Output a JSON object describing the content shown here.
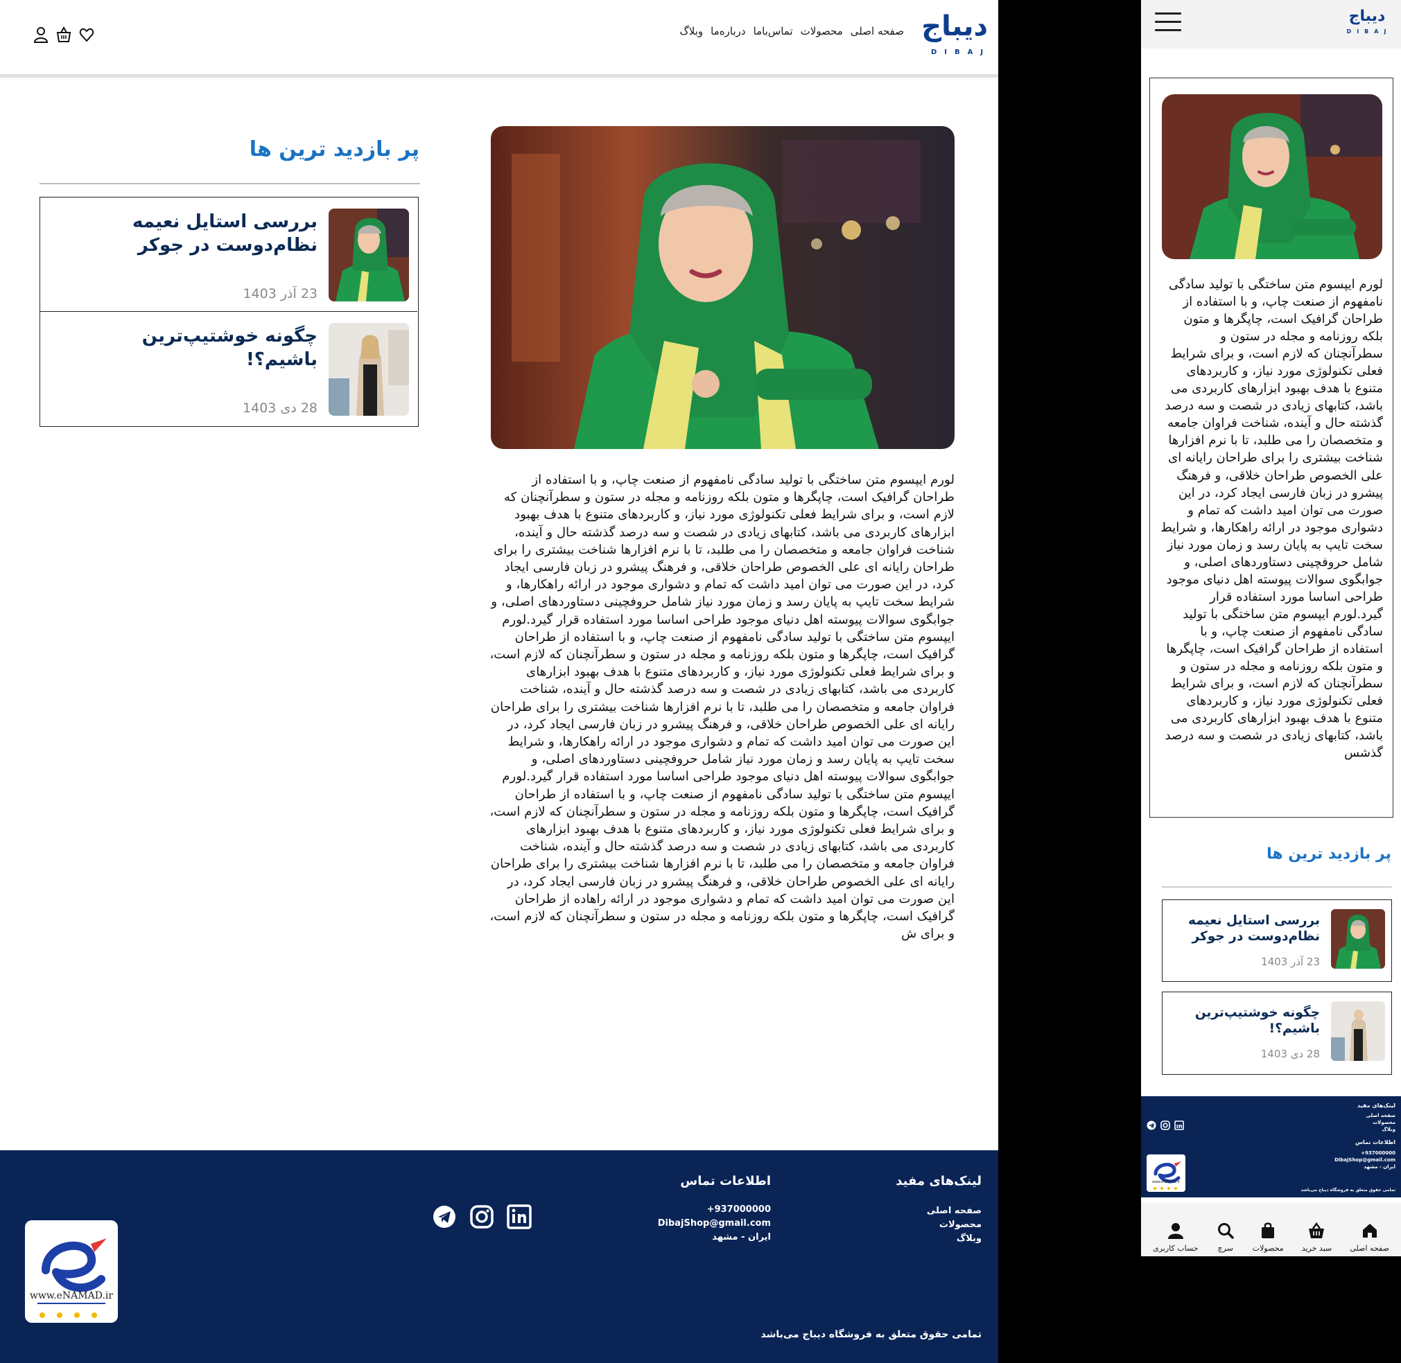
{
  "brand": {
    "name_fa": "دیباج",
    "name_en": "DIBAJ"
  },
  "nav": [
    {
      "label": "صفحه اصلی"
    },
    {
      "label": "محصولات"
    },
    {
      "label": "تماس‌باما"
    },
    {
      "label": "درباره‌ما"
    },
    {
      "label": "وبلاگ"
    }
  ],
  "header_icons": [
    "user-icon",
    "basket-icon",
    "heart-icon"
  ],
  "article": {
    "hero_icon": "article-hero-image",
    "body": "لورم ایپسوم متن ساختگی با تولید سادگی نامفهوم از صنعت چاپ، و با استفاده از طراحان گرافیک است، چاپگرها و متون بلکه روزنامه و مجله در ستون و سطرآنچنان که لازم است، و برای شرایط فعلی تکنولوژی مورد نیاز، و کاربردهای متنوع با هدف بهبود ابزارهای کاربردی می باشد، کتابهای زیادی در شصت و سه درصد گذشته حال و آینده، شناخت فراوان جامعه و متخصصان را می طلبد، تا با نرم افزارها شناخت بیشتری را برای طراحان رایانه ای علی الخصوص طراحان خلاقی، و فرهنگ پیشرو در زبان فارسی ایجاد کرد، در این صورت می توان امید داشت که تمام و دشواری موجود در ارائه راهکارها، و شرایط سخت تایپ به پایان رسد و زمان مورد نیاز شامل حروفچینی دستاوردهای اصلی، و جوابگوی سوالات پیوسته اهل دنیای موجود طراحی اساسا مورد استفاده قرار گیرد.لورم ایپسوم متن ساختگی با تولید سادگی نامفهوم از صنعت چاپ، و با استفاده از طراحان گرافیک است، چاپگرها و متون بلکه روزنامه و مجله در ستون و سطرآنچنان که لازم است، و برای شرایط فعلی تکنولوژی مورد نیاز، و کاربردهای متنوع با هدف بهبود ابزارهای کاربردی می باشد، کتابهای زیادی در شصت و سه درصد گذشته حال و آینده، شناخت فراوان جامعه و متخصصان را می طلبد، تا با نرم افزارها شناخت بیشتری را برای طراحان رایانه ای علی الخصوص طراحان خلاقی، و فرهنگ پیشرو در زبان فارسی ایجاد کرد، در این صورت می توان امید داشت که تمام و دشواری موجود در ارائه راهکارها، و شرایط سخت تایپ به پایان رسد و زمان مورد نیاز شامل حروفچینی دستاوردهای اصلی، و جوابگوی سوالات پیوسته اهل دنیای موجود طراحی اساسا مورد استفاده قرار گیرد.لورم ایپسوم متن ساختگی با تولید سادگی نامفهوم از صنعت چاپ، و با استفاده از طراحان گرافیک است، چاپگرها و متون بلکه روزنامه و مجله در ستون و سطرآنچنان که لازم است، و برای شرایط فعلی تکنولوژی مورد نیاز، و کاربردهای متنوع با هدف بهبود ابزارهای کاربردی می باشد، کتابهای زیادی در شصت و سه درصد گذشته حال و آینده، شناخت فراوان جامعه و متخصصان را می طلبد، تا با نرم افزارها شناخت بیشتری را برای طراحان رایانه ای علی الخصوص طراحان خلاقی، و فرهنگ پیشرو در زبان فارسی ایجاد کرد، در این صورت می توان امید داشت که تمام و دشواری موجود در ارائه راهاده از طراحان گرافیک است، چاپگرها و متون بلکه روزنامه و مجله در ستون و سطرآنچنان که لازم است، و برای ش",
    "mobile_body": "لورم ایپسوم متن ساختگی با تولید سادگی نامفهوم از صنعت چاپ، و با استفاده از طراحان گرافیک است، چاپگرها و متون بلکه روزنامه و مجله در ستون و سطرآنچنان که لازم است، و برای شرایط فعلی تکنولوژی مورد نیاز، و کاربردهای متنوع با هدف بهبود ابزارهای کاربردی می باشد، کتابهای زیادی در شصت و سه درصد گذشته حال و آینده، شناخت فراوان جامعه و متخصصان را می طلبد، تا با نرم افزارها شناخت بیشتری را برای طراحان رایانه ای علی الخصوص طراحان خلاقی، و فرهنگ پیشرو در زبان فارسی ایجاد کرد، در این صورت می توان امید داشت که تمام و دشواری موجود در ارائه راهکارها، و شرایط سخت تایپ به پایان رسد و زمان مورد نیاز شامل حروفچینی دستاوردهای اصلی، و جوابگوی سوالات پیوسته اهل دنیای موجود طراحی اساسا مورد استفاده قرار گیرد.لورم ایپسوم متن ساختگی با تولید سادگی نامفهوم از صنعت چاپ، و با استفاده از طراحان گرافیک است، چاپگرها و متون بلکه روزنامه و مجله در ستون و سطرآنچنان که لازم است، و برای شرایط فعلی تکنولوژی مورد نیاز، و کاربردهای متنوع با هدف بهبود ابزارهای کاربردی می باشد، کتابهای زیادی در شصت و سه درصد گذشس"
  },
  "sidebar": {
    "title": "پر بازدید ترین ها",
    "posts": [
      {
        "title": "بررسی استایل نعیمه نظام‌دوست در جوکر",
        "date": "23 آذر 1403"
      },
      {
        "title": "چگونه خوشتیپ‌ترین باشیم؟!",
        "date": "28 دی 1403"
      }
    ]
  },
  "footer": {
    "links_title": "لینک‌های مفید",
    "links": [
      {
        "label": "صفحه اصلی"
      },
      {
        "label": "محصولات"
      },
      {
        "label": "وبلاگ"
      }
    ],
    "contact_title": "اطلاعات تماس",
    "phone": "+937000000",
    "email": "DibajShop@gmail.com",
    "address": "ایران - مشهد",
    "social": [
      "telegram-icon",
      "instagram-icon",
      "linkedin-icon"
    ],
    "enamad_text": "www.eNAMAD.ir",
    "copyright": "تمامی حقوق متعلق به فروشگاه دیباج می‌باشد"
  },
  "mobile_nav": [
    {
      "label": "صفحه اصلی",
      "icon": "home-icon"
    },
    {
      "label": "سبد خرید",
      "icon": "basket-icon"
    },
    {
      "label": "محصولات",
      "icon": "bag-icon"
    },
    {
      "label": "سرچ",
      "icon": "search-icon"
    },
    {
      "label": "حساب کاربری",
      "icon": "user-icon"
    }
  ],
  "colors": {
    "brand_blue": "#0d3d8c",
    "accent_blue": "#1a73c4",
    "footer_navy": "#0a2456",
    "scarf_green": "#1f9a4c"
  }
}
